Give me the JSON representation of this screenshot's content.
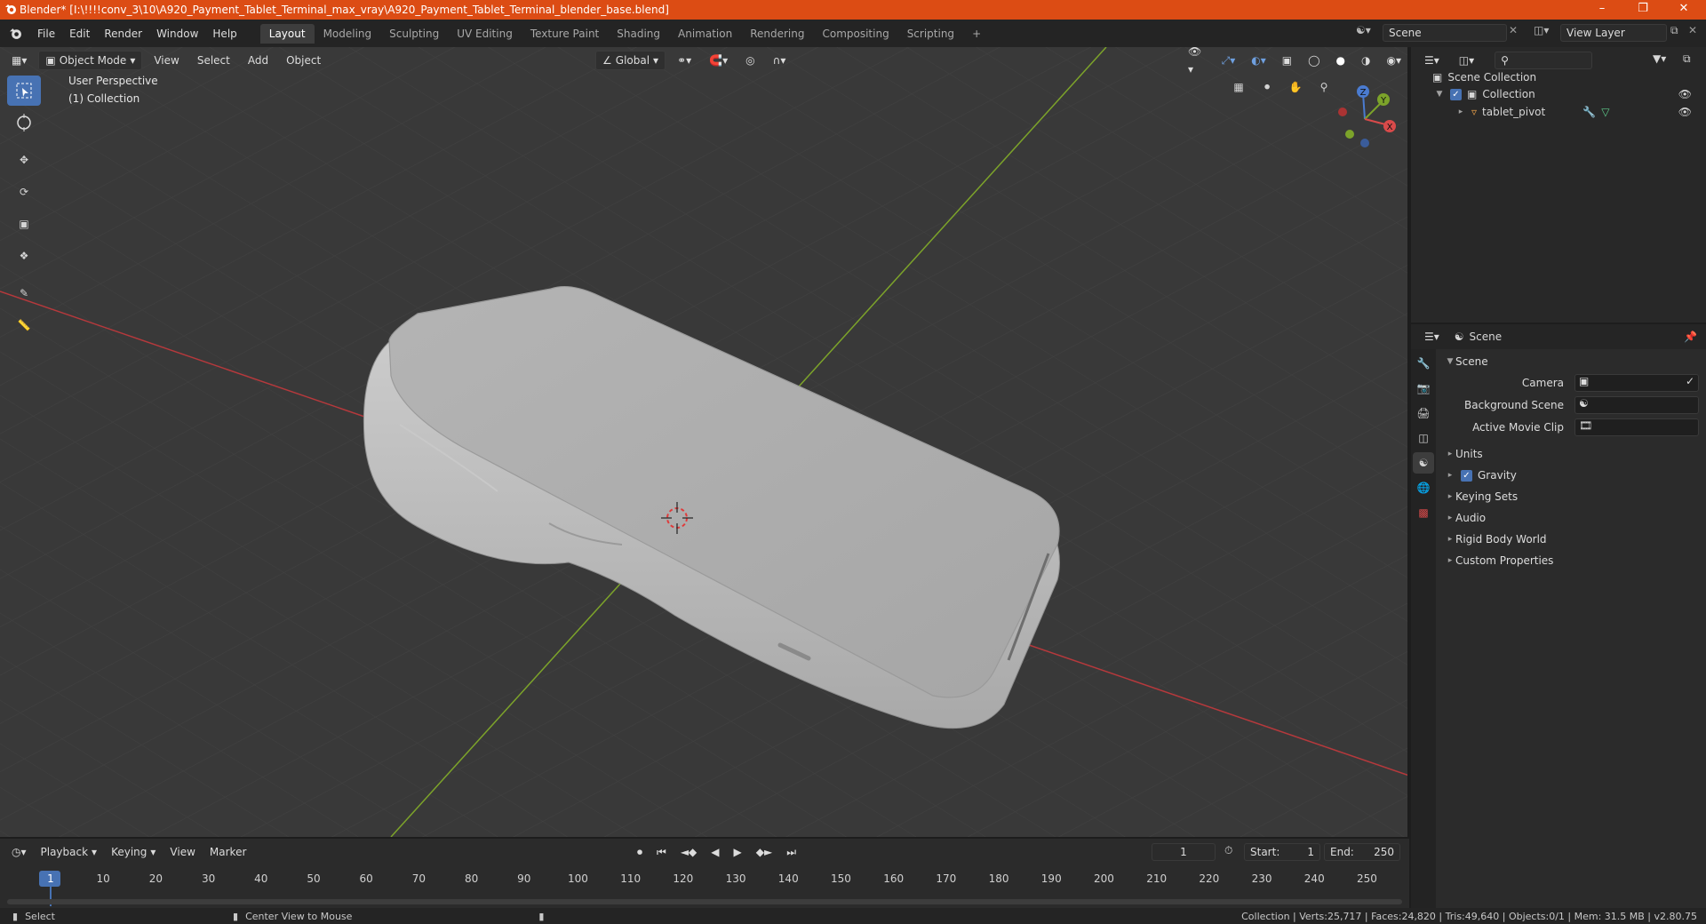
{
  "window": {
    "title": "Blender* [I:\\!!!!conv_3\\10\\A920_Payment_Tablet_Terminal_max_vray\\A920_Payment_Tablet_Terminal_blender_base.blend]"
  },
  "menu": [
    "File",
    "Edit",
    "Render",
    "Window",
    "Help"
  ],
  "workspaces": [
    "Layout",
    "Modeling",
    "Sculpting",
    "UV Editing",
    "Texture Paint",
    "Shading",
    "Animation",
    "Rendering",
    "Compositing",
    "Scripting"
  ],
  "top_right": {
    "scene": "Scene",
    "view_layer": "View Layer"
  },
  "viewport_header": {
    "mode": "Object Mode",
    "menus": [
      "View",
      "Select",
      "Add",
      "Object"
    ],
    "transform": "Global"
  },
  "overlay": {
    "line1": "User Perspective",
    "line2": "(1) Collection"
  },
  "gizmo": {
    "z": "Z",
    "y": "Y",
    "x": "X"
  },
  "outliner": {
    "root": "Scene Collection",
    "collection": "Collection",
    "object": "tablet_pivot"
  },
  "properties": {
    "header": "Scene",
    "section": "Scene",
    "camera_label": "Camera",
    "bg_label": "Background Scene",
    "clip_label": "Active Movie Clip",
    "panels": [
      "Units",
      "Gravity",
      "Keying Sets",
      "Audio",
      "Rigid Body World",
      "Custom Properties"
    ]
  },
  "timeline": {
    "menus": [
      "Playback",
      "Keying",
      "View",
      "Marker"
    ],
    "current": "1",
    "start_label": "Start:",
    "start": "1",
    "end_label": "End:",
    "end": "250",
    "ruler": [
      "1",
      "10",
      "20",
      "30",
      "40",
      "50",
      "60",
      "70",
      "80",
      "90",
      "100",
      "110",
      "120",
      "130",
      "140",
      "150",
      "160",
      "170",
      "180",
      "190",
      "200",
      "210",
      "220",
      "230",
      "240",
      "250"
    ]
  },
  "status": {
    "left1": "Select",
    "left2": "Center View to Mouse",
    "right": "Collection | Verts:25,717 | Faces:24,820 | Tris:49,640 | Objects:0/1 | Mem: 31.5 MB | v2.80.75"
  },
  "colors": {
    "title": "#dc4c14",
    "accent": "#4772b3",
    "xaxis": "#c03a3a",
    "yaxis": "#7ca32a"
  }
}
